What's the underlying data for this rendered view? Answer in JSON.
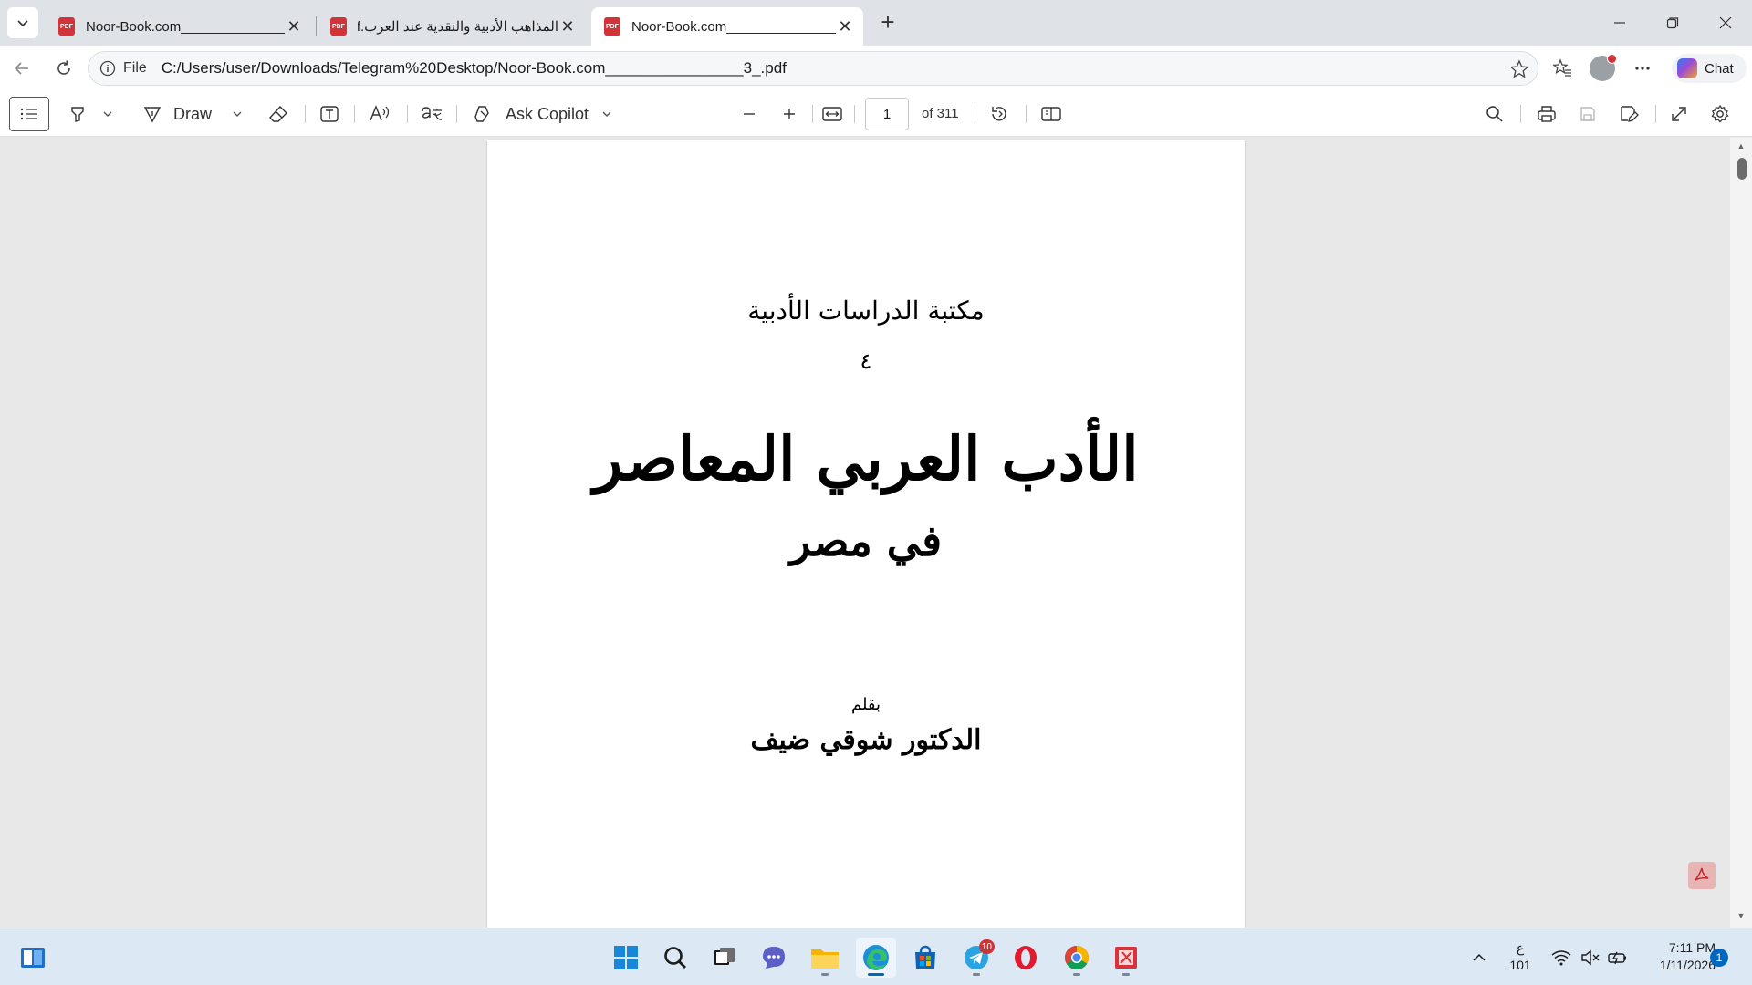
{
  "tabs": [
    {
      "title": "Noor-Book.com_______________",
      "active": false
    },
    {
      "title": "المذاهب الأدبية والنقدية عند العرب.pdf",
      "active": false
    },
    {
      "title": "Noor-Book.com_______________",
      "active": true
    }
  ],
  "address": {
    "scheme_label": "File",
    "url": "C:/Users/user/Downloads/Telegram%20Desktop/Noor-Book.com________________3_.pdf"
  },
  "chat_label": "Chat",
  "toolbar": {
    "draw_label": "Draw",
    "ask_copilot_label": "Ask Copilot",
    "page_current": "1",
    "page_total": "of 311"
  },
  "page": {
    "series": "مكتبة الدراسات الأدبية",
    "number": "٤",
    "title": "الأدب العربي المعاصر",
    "subtitle": "في مصر",
    "by": "بقلم",
    "author": "الدكتور شوقي ضيف"
  },
  "taskbar": {
    "telegram_badge": "10",
    "lang_line1": "ع",
    "lang_line2": "101",
    "time": "7:11 PM",
    "date": "1/11/2026",
    "notifications": "1"
  },
  "colors": {
    "accent": "#0067c0",
    "pdf_red": "#d13438",
    "taskbar": "#dde8f5"
  }
}
